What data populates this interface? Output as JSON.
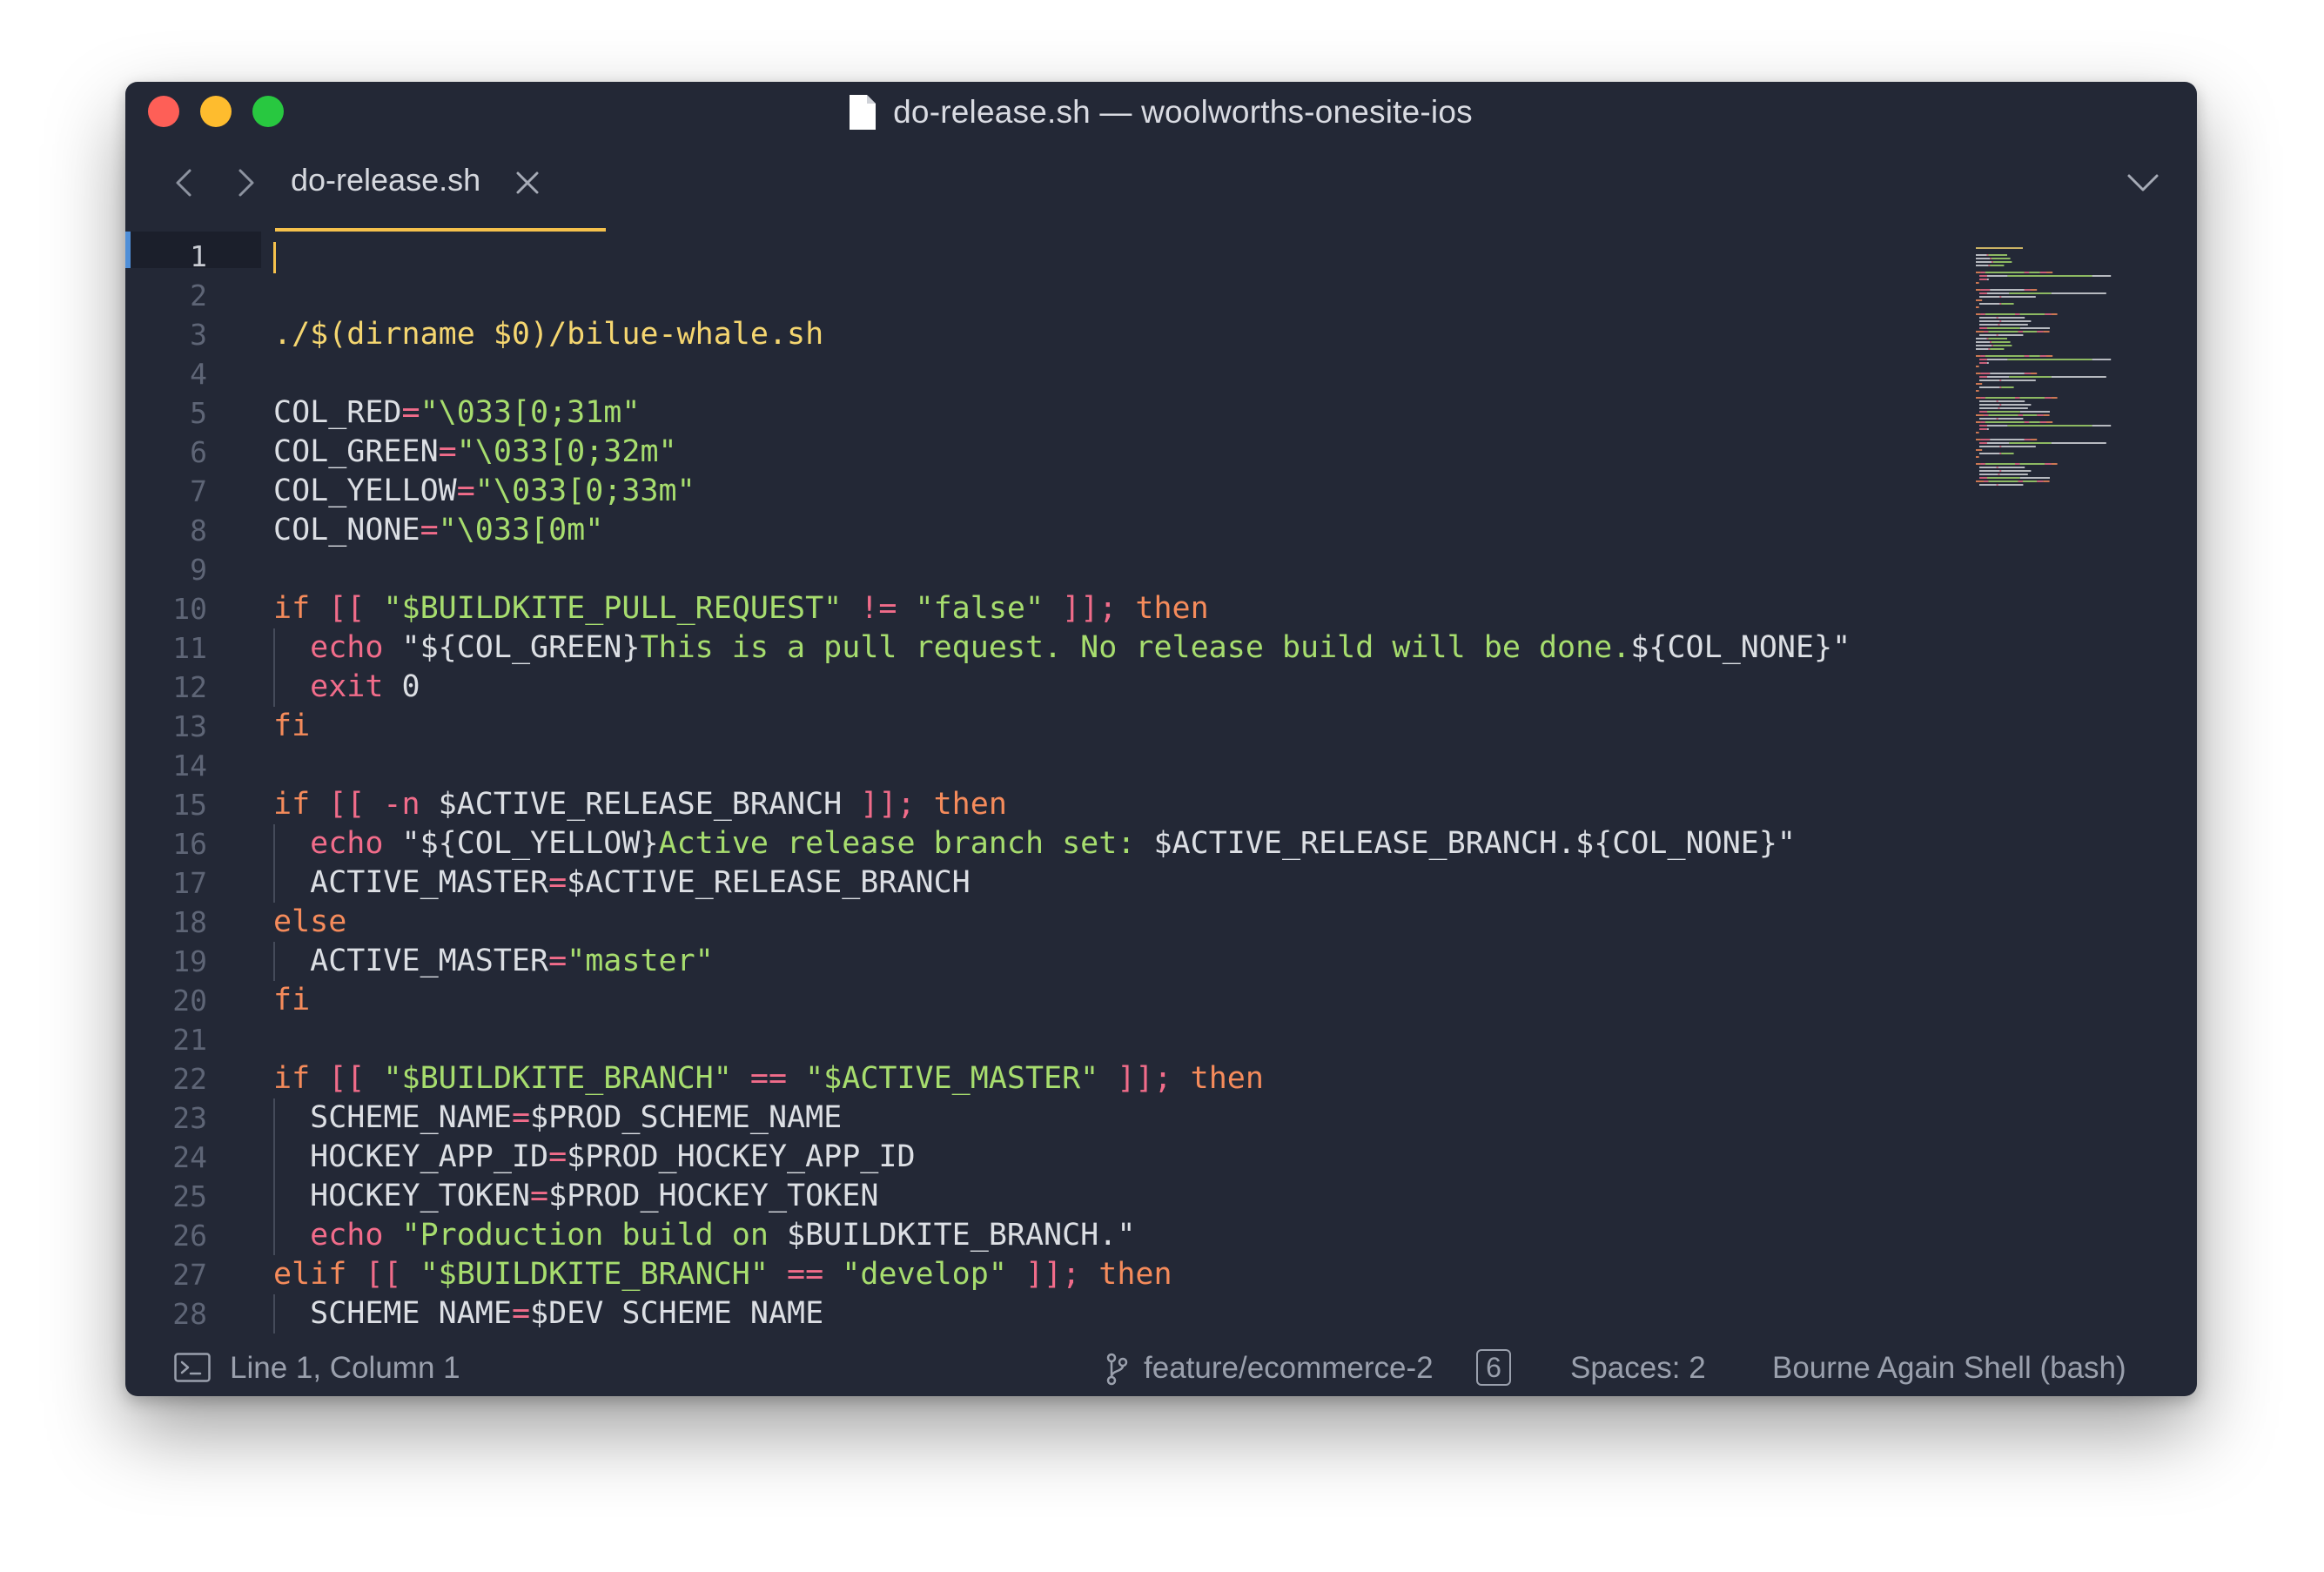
{
  "window": {
    "title": "do-release.sh — woolworths-onesite-ios",
    "controls": {
      "close_color": "#fe5f57",
      "minimize_color": "#febc2e",
      "maximize_color": "#28c840"
    }
  },
  "tabs": [
    {
      "label": "do-release.sh",
      "active": true
    }
  ],
  "editor": {
    "accent": "#f5c14c",
    "lines": [
      {
        "n": "1",
        "tokens": []
      },
      {
        "n": "2",
        "tokens": []
      },
      {
        "n": "3",
        "tokens": [
          {
            "t": "./$(dirname $0)/bilue-whale.sh",
            "c": "t-path"
          }
        ]
      },
      {
        "n": "4",
        "tokens": []
      },
      {
        "n": "5",
        "tokens": [
          {
            "t": "COL_RED",
            "c": "t-def"
          },
          {
            "t": "=",
            "c": "t-op"
          },
          {
            "t": "\"\\033[0;31m\"",
            "c": "t-str"
          }
        ]
      },
      {
        "n": "6",
        "tokens": [
          {
            "t": "COL_GREEN",
            "c": "t-def"
          },
          {
            "t": "=",
            "c": "t-op"
          },
          {
            "t": "\"\\033[0;32m\"",
            "c": "t-str"
          }
        ]
      },
      {
        "n": "7",
        "tokens": [
          {
            "t": "COL_YELLOW",
            "c": "t-def"
          },
          {
            "t": "=",
            "c": "t-op"
          },
          {
            "t": "\"\\033[0;33m\"",
            "c": "t-str"
          }
        ]
      },
      {
        "n": "8",
        "tokens": [
          {
            "t": "COL_NONE",
            "c": "t-def"
          },
          {
            "t": "=",
            "c": "t-op"
          },
          {
            "t": "\"\\033[0m\"",
            "c": "t-str"
          }
        ]
      },
      {
        "n": "9",
        "tokens": []
      },
      {
        "n": "10",
        "tokens": [
          {
            "t": "if ",
            "c": "t-kw"
          },
          {
            "t": "[[ ",
            "c": "t-op"
          },
          {
            "t": "\"$BUILDKITE_PULL_REQUEST\"",
            "c": "t-str"
          },
          {
            "t": " != ",
            "c": "t-op"
          },
          {
            "t": "\"false\"",
            "c": "t-str"
          },
          {
            "t": " ]]; ",
            "c": "t-op"
          },
          {
            "t": "then",
            "c": "t-kw"
          }
        ]
      },
      {
        "n": "11",
        "indent": true,
        "tokens": [
          {
            "t": "  echo ",
            "c": "t-echo"
          },
          {
            "t": "\"${COL_GREEN}",
            "c": "t-def"
          },
          {
            "t": "This is a pull request. No release build will be done.",
            "c": "t-str"
          },
          {
            "t": "${COL_NONE}\"",
            "c": "t-def"
          }
        ]
      },
      {
        "n": "12",
        "indent": true,
        "tokens": [
          {
            "t": "  exit ",
            "c": "t-echo"
          },
          {
            "t": "0",
            "c": "t-num"
          }
        ]
      },
      {
        "n": "13",
        "tokens": [
          {
            "t": "fi",
            "c": "t-kw"
          }
        ]
      },
      {
        "n": "14",
        "tokens": []
      },
      {
        "n": "15",
        "tokens": [
          {
            "t": "if ",
            "c": "t-kw"
          },
          {
            "t": "[[ -n ",
            "c": "t-op"
          },
          {
            "t": "$ACTIVE_RELEASE_BRANCH",
            "c": "t-var"
          },
          {
            "t": " ]]; ",
            "c": "t-op"
          },
          {
            "t": "then",
            "c": "t-kw"
          }
        ]
      },
      {
        "n": "16",
        "indent": true,
        "tokens": [
          {
            "t": "  echo ",
            "c": "t-echo"
          },
          {
            "t": "\"${COL_YELLOW}",
            "c": "t-def"
          },
          {
            "t": "Active release branch set: ",
            "c": "t-str"
          },
          {
            "t": "$ACTIVE_RELEASE_BRANCH.${COL_NONE}\"",
            "c": "t-def"
          }
        ]
      },
      {
        "n": "17",
        "indent": true,
        "tokens": [
          {
            "t": "  ACTIVE_MASTER",
            "c": "t-def"
          },
          {
            "t": "=",
            "c": "t-op"
          },
          {
            "t": "$ACTIVE_RELEASE_BRANCH",
            "c": "t-var"
          }
        ]
      },
      {
        "n": "18",
        "tokens": [
          {
            "t": "else",
            "c": "t-kw"
          }
        ]
      },
      {
        "n": "19",
        "indent": true,
        "tokens": [
          {
            "t": "  ACTIVE_MASTER",
            "c": "t-def"
          },
          {
            "t": "=",
            "c": "t-op"
          },
          {
            "t": "\"master\"",
            "c": "t-str"
          }
        ]
      },
      {
        "n": "20",
        "tokens": [
          {
            "t": "fi",
            "c": "t-kw"
          }
        ]
      },
      {
        "n": "21",
        "tokens": []
      },
      {
        "n": "22",
        "tokens": [
          {
            "t": "if ",
            "c": "t-kw"
          },
          {
            "t": "[[ ",
            "c": "t-op"
          },
          {
            "t": "\"$BUILDKITE_BRANCH\"",
            "c": "t-str"
          },
          {
            "t": " == ",
            "c": "t-op"
          },
          {
            "t": "\"$ACTIVE_MASTER\"",
            "c": "t-str"
          },
          {
            "t": " ]]; ",
            "c": "t-op"
          },
          {
            "t": "then",
            "c": "t-kw"
          }
        ]
      },
      {
        "n": "23",
        "indent": true,
        "tokens": [
          {
            "t": "  SCHEME_NAME",
            "c": "t-def"
          },
          {
            "t": "=",
            "c": "t-op"
          },
          {
            "t": "$PROD_SCHEME_NAME",
            "c": "t-var"
          }
        ]
      },
      {
        "n": "24",
        "indent": true,
        "tokens": [
          {
            "t": "  HOCKEY_APP_ID",
            "c": "t-def"
          },
          {
            "t": "=",
            "c": "t-op"
          },
          {
            "t": "$PROD_HOCKEY_APP_ID",
            "c": "t-var"
          }
        ]
      },
      {
        "n": "25",
        "indent": true,
        "tokens": [
          {
            "t": "  HOCKEY_TOKEN",
            "c": "t-def"
          },
          {
            "t": "=",
            "c": "t-op"
          },
          {
            "t": "$PROD_HOCKEY_TOKEN",
            "c": "t-var"
          }
        ]
      },
      {
        "n": "26",
        "indent": true,
        "tokens": [
          {
            "t": "  echo ",
            "c": "t-echo"
          },
          {
            "t": "\"Production build on ",
            "c": "t-str"
          },
          {
            "t": "$BUILDKITE_BRANCH.\"",
            "c": "t-def"
          }
        ]
      },
      {
        "n": "27",
        "tokens": [
          {
            "t": "elif ",
            "c": "t-kw"
          },
          {
            "t": "[[ ",
            "c": "t-op"
          },
          {
            "t": "\"$BUILDKITE_BRANCH\"",
            "c": "t-str"
          },
          {
            "t": " == ",
            "c": "t-op"
          },
          {
            "t": "\"develop\"",
            "c": "t-str"
          },
          {
            "t": " ]]; ",
            "c": "t-op"
          },
          {
            "t": "then",
            "c": "t-kw"
          }
        ]
      },
      {
        "n": "28",
        "indent": true,
        "tokens": [
          {
            "t": "  SCHEME NAME",
            "c": "t-def"
          },
          {
            "t": "=",
            "c": "t-op"
          },
          {
            "t": "$DEV SCHEME NAME",
            "c": "t-var"
          }
        ]
      }
    ]
  },
  "statusbar": {
    "cursor_position": "Line 1, Column 1",
    "branch": "feature/ecommerce-2",
    "branch_badge": "6",
    "spaces": "Spaces: 2",
    "syntax": "Bourne Again Shell (bash)"
  },
  "icons": {
    "file": "file-icon",
    "back": "chevron-left-icon",
    "forward": "chevron-right-icon",
    "tab_close": "close-icon",
    "tabs_menu": "chevron-down-icon",
    "terminal": "terminal-icon",
    "branch": "git-branch-icon"
  }
}
